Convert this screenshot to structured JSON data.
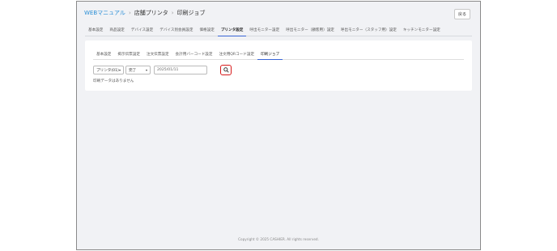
{
  "header": {
    "breadcrumb_root": "WEBマニュアル",
    "breadcrumb_mid": "店舗プリンタ",
    "breadcrumb_current": "印刷ジョブ",
    "back_label": "戻る"
  },
  "main_tabs": [
    {
      "label": "基本設定",
      "active": false
    },
    {
      "label": "商品設定",
      "active": false
    },
    {
      "label": "デバイス設定",
      "active": false
    },
    {
      "label": "デバイス別会員設定",
      "active": false
    },
    {
      "label": "価格設定",
      "active": false
    },
    {
      "label": "プリンタ設定",
      "active": true
    },
    {
      "label": "呼出モニター設定",
      "active": false
    },
    {
      "label": "呼出モニター（顧客用）設定",
      "active": false
    },
    {
      "label": "呼出モニター（スタッフ用）設定",
      "active": false
    },
    {
      "label": "キッチンモニター設定",
      "active": false
    }
  ],
  "sub_tabs": [
    {
      "label": "基本設定",
      "active": false
    },
    {
      "label": "掲示伝票設定",
      "active": false
    },
    {
      "label": "注文伝票設定",
      "active": false
    },
    {
      "label": "会計用バーコード設定",
      "active": false
    },
    {
      "label": "注文用QRコード設定",
      "active": false
    },
    {
      "label": "印刷ジョブ",
      "active": true
    }
  ],
  "filters": {
    "printer_value": "プリンタ(01)",
    "status_value": "完了",
    "date_value": "2025/01/11"
  },
  "no_data": "印刷データはありません",
  "footer": "Copyright © 2025 CASHIER. All rights reserved.",
  "colors": {
    "accent": "#3a66d6",
    "link": "#2b8fd6",
    "highlight": "#d7191a"
  }
}
